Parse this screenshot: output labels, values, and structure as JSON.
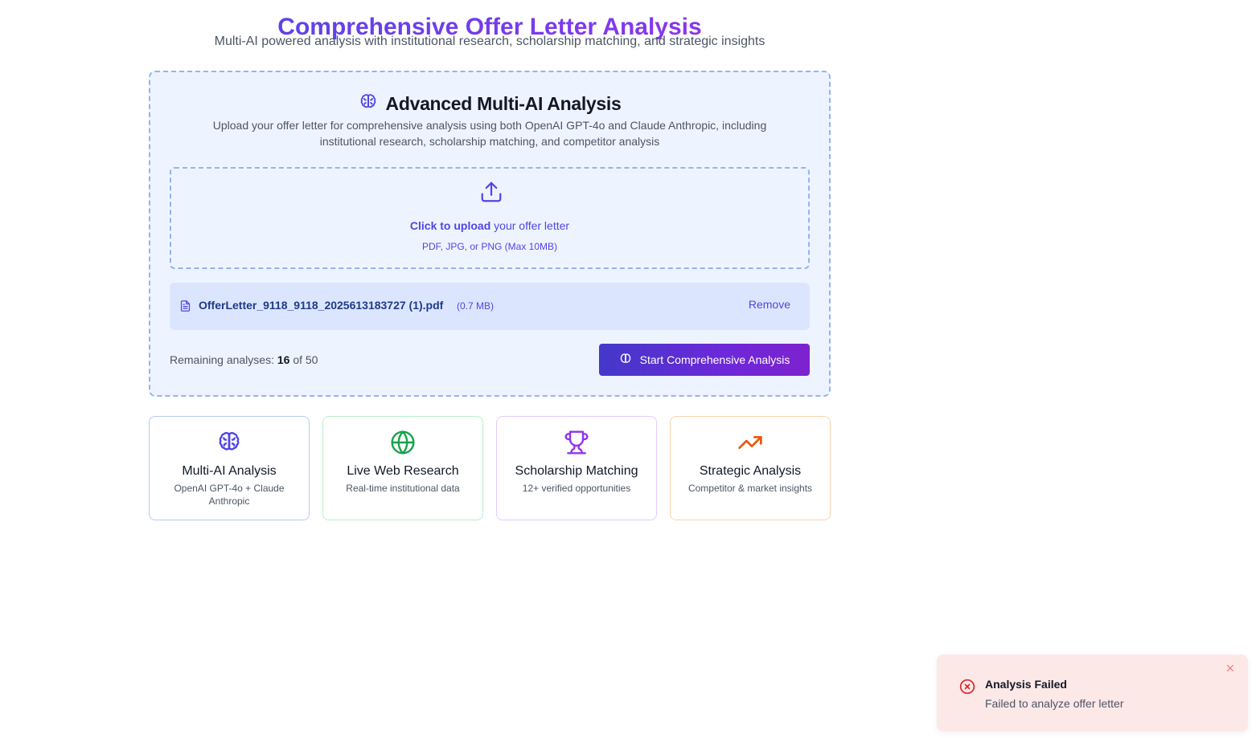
{
  "header": {
    "title": "Comprehensive Offer Letter Analysis",
    "subtitle": "Multi-AI powered analysis with institutional research, scholarship matching, and strategic insights"
  },
  "analysis_card": {
    "title": "Advanced Multi-AI Analysis",
    "description": "Upload your offer letter for comprehensive analysis using both OpenAI GPT-4o and Claude Anthropic, including institutional research, scholarship matching, and competitor analysis",
    "upload": {
      "cta_strong": "Click to upload",
      "cta_rest": " your offer letter",
      "hint": "PDF, JPG, or PNG (Max 10MB)"
    },
    "file": {
      "name": "OfferLetter_9118_9118_2025613183727 (1).pdf",
      "size": "(0.7 MB)",
      "remove_label": "Remove"
    },
    "remaining": {
      "prefix": "Remaining analyses: ",
      "count": "16",
      "suffix": " of 50"
    },
    "start_button_label": "Start Comprehensive Analysis"
  },
  "features": [
    {
      "title": "Multi-AI Analysis",
      "description": "OpenAI GPT-4o + Claude Anthropic",
      "icon": "brain-icon",
      "color": "#4f46e5"
    },
    {
      "title": "Live Web Research",
      "description": "Real-time institutional data",
      "icon": "globe-icon",
      "color": "#16a34a"
    },
    {
      "title": "Scholarship Matching",
      "description": "12+ verified opportunities",
      "icon": "trophy-icon",
      "color": "#9333ea"
    },
    {
      "title": "Strategic Analysis",
      "description": "Competitor & market insights",
      "icon": "trending-up-icon",
      "color": "#ea580c"
    }
  ],
  "toast": {
    "title": "Analysis Failed",
    "message": "Failed to analyze offer letter",
    "icon": "x-circle-icon",
    "color": "#dc2626"
  },
  "colors": {
    "accent": "#4f46e5",
    "card_bg": "#eef4ff",
    "file_row_bg": "#dbe6fe",
    "toast_bg": "#fde8e8"
  }
}
